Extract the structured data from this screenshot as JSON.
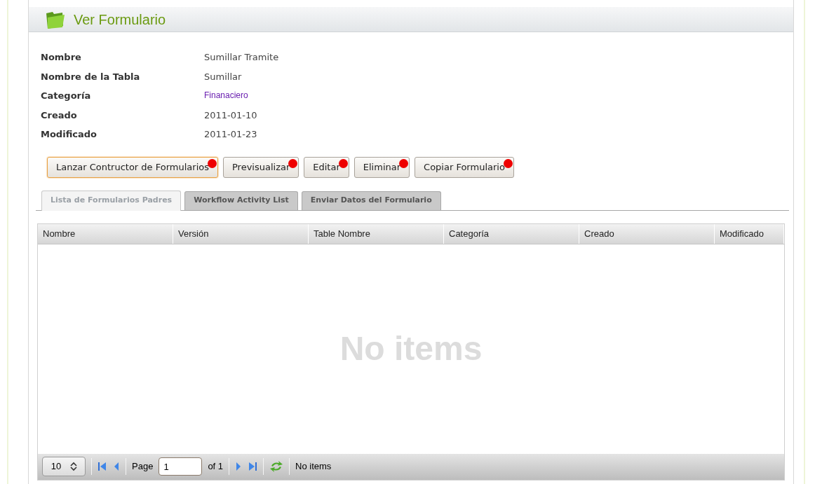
{
  "header": {
    "title": "Ver Formulario"
  },
  "details": [
    {
      "label": "Nombre",
      "value": "Sumillar Tramite",
      "kind": "text"
    },
    {
      "label": "Nombre de la Tabla",
      "value": "Sumillar",
      "kind": "text"
    },
    {
      "label": "Categoría",
      "value": "Finanaciero",
      "kind": "link"
    },
    {
      "label": "Creado",
      "value": "2011-01-10",
      "kind": "text"
    },
    {
      "label": "Modificado",
      "value": "2011-01-23",
      "kind": "text"
    }
  ],
  "buttons": [
    {
      "label": "Lanzar Contructor de Formularios",
      "focused": true,
      "marked": true
    },
    {
      "label": "Previsualizar",
      "focused": false,
      "marked": true
    },
    {
      "label": "Editar",
      "focused": false,
      "marked": true
    },
    {
      "label": "Eliminar",
      "focused": false,
      "marked": true
    },
    {
      "label": "Copiar Formulario",
      "focused": false,
      "marked": true
    }
  ],
  "tabs": [
    {
      "label": "Lista de Formularios Padres",
      "selected": true
    },
    {
      "label": "Workflow Activity List",
      "selected": false
    },
    {
      "label": "Enviar Datos del Formulario",
      "selected": false
    }
  ],
  "table": {
    "columns": [
      "Nombre",
      "Versión",
      "Table Nombre",
      "Categoría",
      "Creado",
      "Modificado"
    ],
    "empty_message": "No items"
  },
  "pager": {
    "page_size": "10",
    "page_label": "Page",
    "page_value": "1",
    "page_total": "of 1",
    "status": "No items"
  }
}
